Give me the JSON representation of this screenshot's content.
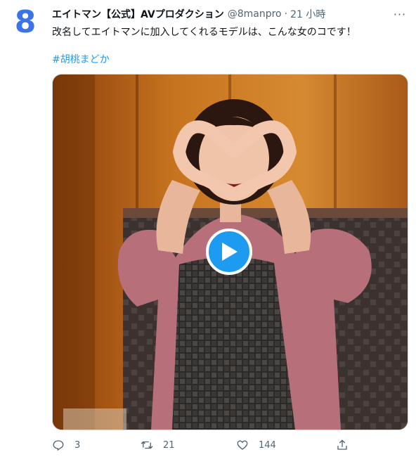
{
  "tweet": {
    "avatar_glyph": "8",
    "display_name": "エイトマン【公式】AVプロダクション",
    "handle": "@8manpro",
    "separator": "·",
    "time": "21 小時",
    "more_glyph": "···",
    "text": "改名してエイトマンに加入してくれるモデルは、こんな女のコです！",
    "hashtag": "#胡桃まどか"
  },
  "media": {
    "type": "video",
    "play_icon": "play-icon"
  },
  "actions": {
    "reply_count": "3",
    "retweet_count": "21",
    "like_count": "144"
  },
  "colors": {
    "accent": "#1d9bf0",
    "secondary_text": "#536471",
    "avatar_brand": "#3b73e8"
  }
}
